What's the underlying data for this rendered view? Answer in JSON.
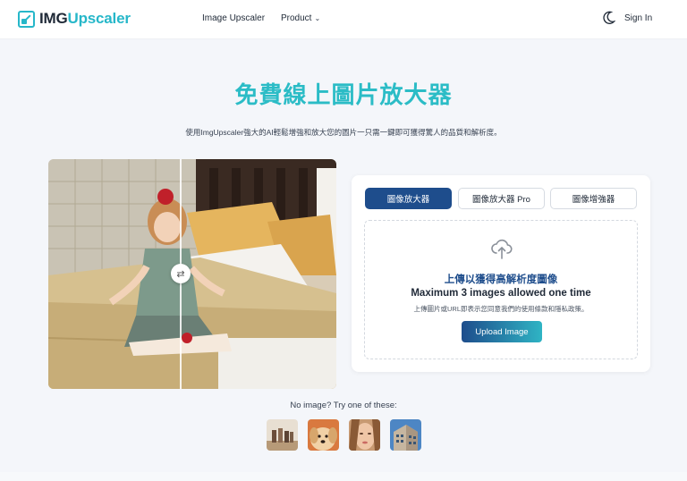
{
  "header": {
    "logo_part1": "IMG",
    "logo_part2": "Upscaler",
    "nav": {
      "image_upscaler": "Image Upscaler",
      "product": "Product"
    },
    "theme_icon": "moon-icon",
    "sign_in": "Sign In"
  },
  "hero": {
    "title": "免費線上圖片放大器",
    "subtitle": "使用ImgUpscaler強大的AI輕鬆增強和放大您的圖片一只需一鍵即可獲得驚人的品質和解析度。"
  },
  "upload_card": {
    "tabs": [
      {
        "label": "圖像放大器",
        "active": true
      },
      {
        "label": "圖像放大器 Pro",
        "active": false
      },
      {
        "label": "圖像增強器",
        "active": false
      }
    ],
    "dropzone": {
      "icon": "cloud-upload-icon",
      "title": "上傳以獲得高解析度圖像",
      "limit": "Maximum 3 images allowed one time",
      "terms": "上傳圖片或URL即表示您同意我們的使用條款和隱私政策。",
      "button": "Upload Image"
    }
  },
  "samples": {
    "label": "No image? Try one of these:"
  },
  "colors": {
    "brand_teal": "#2bbcc6",
    "brand_navy": "#1e4d8c",
    "background": "#f4f6fa"
  }
}
